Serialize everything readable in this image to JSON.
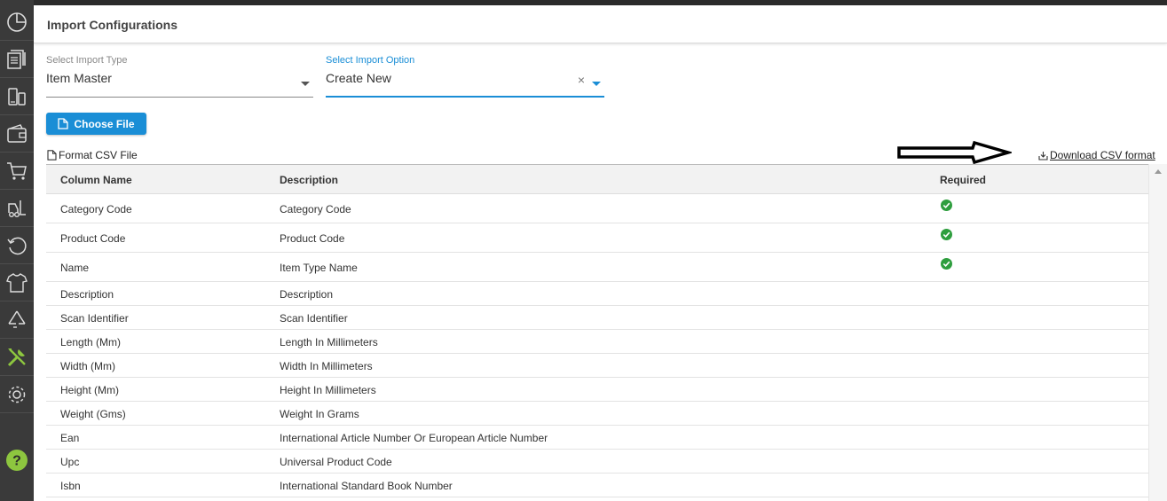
{
  "header": {
    "title": "Import Configurations"
  },
  "sidebar": {
    "items": [
      {
        "icon": "dashboard-icon"
      },
      {
        "icon": "documents-icon"
      },
      {
        "icon": "device-icon"
      },
      {
        "icon": "wallet-icon"
      },
      {
        "icon": "cart-icon"
      },
      {
        "icon": "forklift-icon"
      },
      {
        "icon": "refresh-icon"
      },
      {
        "icon": "shirt-icon"
      },
      {
        "icon": "recycle-icon"
      },
      {
        "icon": "tools-icon"
      },
      {
        "icon": "gear-icon"
      }
    ],
    "help_icon": "help-icon",
    "accent_color": "#8dc63f"
  },
  "form": {
    "import_type": {
      "label": "Select Import Type",
      "value": "Item Master"
    },
    "import_option": {
      "label": "Select Import Option",
      "value": "Create New",
      "clear": "×"
    },
    "choose_file": "Choose File"
  },
  "format": {
    "label": "Format CSV File",
    "download": "Download CSV format"
  },
  "table": {
    "headers": {
      "column_name": "Column Name",
      "description": "Description",
      "required": "Required"
    },
    "rows": [
      {
        "name": "Category Code",
        "description": "Category Code",
        "required": true
      },
      {
        "name": "Product Code",
        "description": "Product Code",
        "required": true
      },
      {
        "name": "Name",
        "description": "Item Type Name",
        "required": true
      },
      {
        "name": "Description",
        "description": "Description",
        "required": false
      },
      {
        "name": "Scan Identifier",
        "description": "Scan Identifier",
        "required": false
      },
      {
        "name": "Length (Mm)",
        "description": "Length In Millimeters",
        "required": false
      },
      {
        "name": "Width (Mm)",
        "description": "Width In Millimeters",
        "required": false
      },
      {
        "name": "Height (Mm)",
        "description": "Height In Millimeters",
        "required": false
      },
      {
        "name": "Weight (Gms)",
        "description": "Weight In Grams",
        "required": false
      },
      {
        "name": "Ean",
        "description": "International Article Number Or European Article Number",
        "required": false
      },
      {
        "name": "Upc",
        "description": "Universal Product Code",
        "required": false
      },
      {
        "name": "Isbn",
        "description": "International Standard Book Number",
        "required": false
      }
    ]
  },
  "colors": {
    "primary": "#1a8ed6",
    "check": "#2e9e3e",
    "sidebar": "#3a3a3a"
  }
}
